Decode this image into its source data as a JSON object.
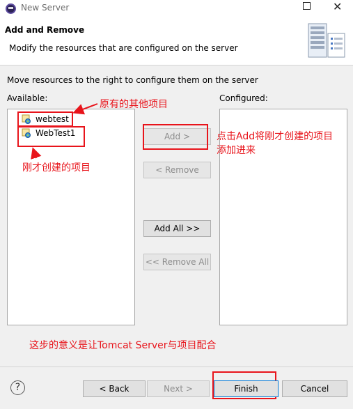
{
  "window": {
    "title": "New Server"
  },
  "header": {
    "title": "Add and Remove",
    "description": "Modify the resources that are configured on the server"
  },
  "instruction": "Move resources to the right to configure them on the server",
  "available": {
    "label": "Available:",
    "items": [
      {
        "label": "webtest"
      },
      {
        "label": "WebTest1"
      }
    ]
  },
  "configured": {
    "label": "Configured:",
    "items": []
  },
  "buttons": {
    "add": "Add >",
    "remove": "< Remove",
    "add_all": "Add All >>",
    "remove_all": "<< Remove All"
  },
  "footer": {
    "back": "< Back",
    "next": "Next >",
    "finish": "Finish",
    "cancel": "Cancel"
  },
  "annotations": {
    "original_projects": "原有的其他项目",
    "new_project": "刚才创建的项目",
    "click_add": "点击Add将刚才创建的项目",
    "click_add_line2": "添加进来",
    "meaning": "这步的意义是让Tomcat Server与项目配合"
  },
  "colors": {
    "annotation": "#e8141b",
    "accent": "#0078d7"
  }
}
